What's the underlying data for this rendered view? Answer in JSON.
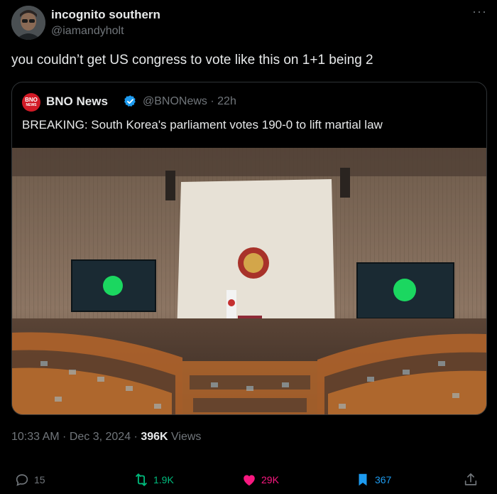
{
  "author": {
    "name": "incognito southern",
    "handle": "@iamandyholt"
  },
  "more_icon": "more-dots-icon",
  "tweet": {
    "text": "you couldn’t get US congress to vote like this on 1+1 being 2"
  },
  "quote": {
    "logo_text": "BNO",
    "logo_subtext": "NEWS",
    "name": "BNO News",
    "handle_time": "@BNONews · 22h",
    "text": "BREAKING: South Korea's parliament votes 190-0 to lift martial law"
  },
  "meta": {
    "time_date": "10:33 AM · Dec 3, 2024 · ",
    "views_count": "396K",
    "views_label": " Views"
  },
  "actions": {
    "reply_count": "15",
    "retweet_count": "1.9K",
    "like_count": "29K",
    "bookmark_count": "367"
  },
  "colors": {
    "background": "#000000",
    "text": "#e7e9ea",
    "muted": "#71767b",
    "verified": "#1d9bf0",
    "retweet": "#00ba7c",
    "like": "#f91880",
    "bookmark": "#1d9bf0"
  }
}
